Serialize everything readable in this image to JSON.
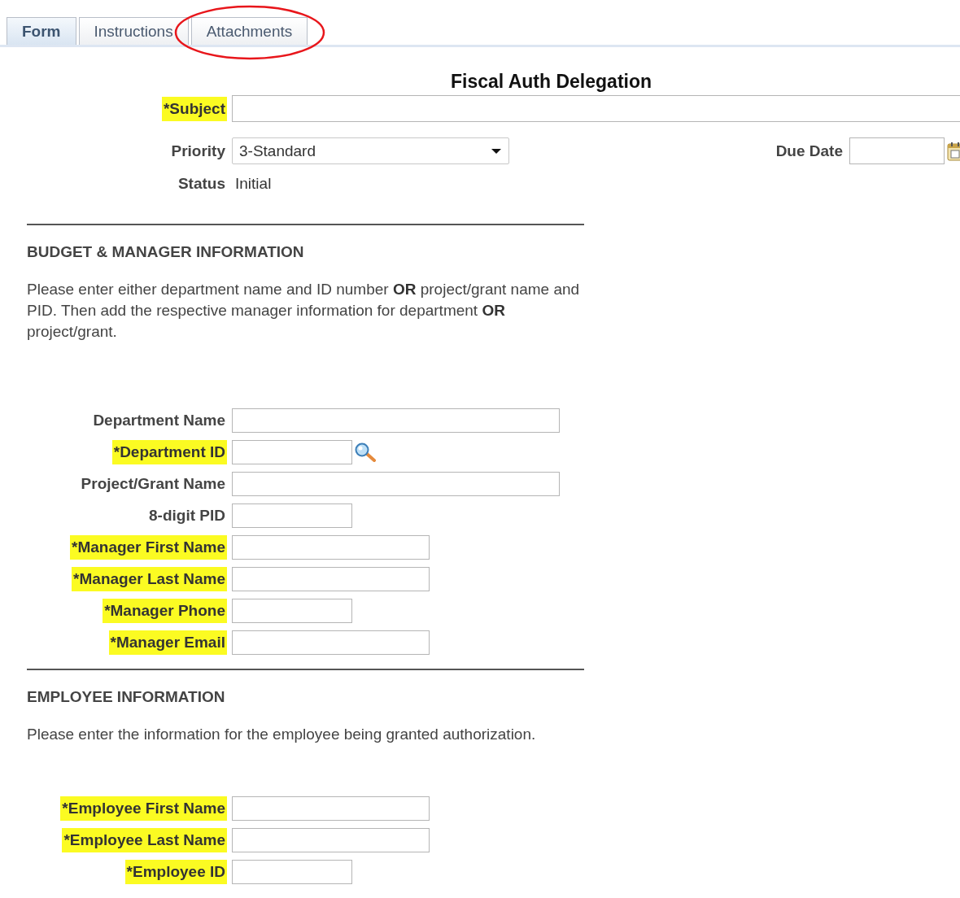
{
  "tabs": [
    {
      "label": "Form",
      "selected": true
    },
    {
      "label": "Instructions",
      "selected": false
    },
    {
      "label": "Attachments",
      "selected": false,
      "circled": true
    }
  ],
  "title": "Fiscal Auth Delegation",
  "subject": {
    "label": "*Subject",
    "highlighted": true
  },
  "priority": {
    "label": "Priority",
    "value": "3-Standard"
  },
  "due_date": {
    "label": "Due Date"
  },
  "status": {
    "label": "Status",
    "value": "Initial"
  },
  "sections": [
    {
      "heading": "BUDGET & MANAGER INFORMATION",
      "text": "Please enter either department name and ID number **OR** project/grant name and PID. Then add the respective manager information for department **OR** project/grant.",
      "fields": [
        {
          "label": "Department Name",
          "kind": "long",
          "highlighted": false
        },
        {
          "label": "*Department ID",
          "kind": "lookup",
          "highlighted": true
        },
        {
          "label": "Project/Grant Name",
          "kind": "long",
          "highlighted": false
        },
        {
          "label": "8-digit PID",
          "kind": "short",
          "highlighted": false
        },
        {
          "label": "*Manager First Name",
          "kind": "medium",
          "highlighted": true
        },
        {
          "label": "*Manager Last Name",
          "kind": "medium",
          "highlighted": true
        },
        {
          "label": "*Manager Phone",
          "kind": "short",
          "highlighted": true
        },
        {
          "label": "*Manager Email",
          "kind": "medium",
          "highlighted": true
        }
      ]
    },
    {
      "heading": "EMPLOYEE INFORMATION",
      "text": "Please enter the information for the employee being granted authorization.",
      "fields": [
        {
          "label": "*Employee First Name",
          "kind": "medium",
          "highlighted": true
        },
        {
          "label": "*Employee Last Name",
          "kind": "medium",
          "highlighted": true
        },
        {
          "label": "*Employee ID",
          "kind": "short",
          "highlighted": true
        }
      ]
    }
  ]
}
